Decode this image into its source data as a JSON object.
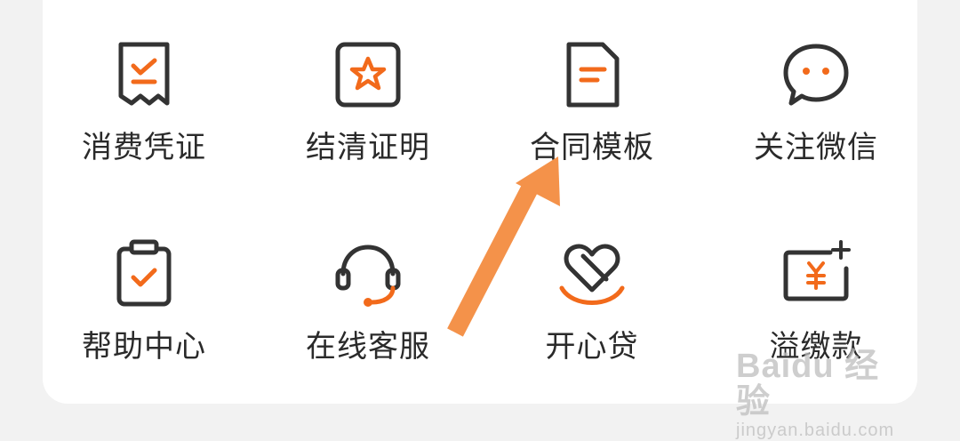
{
  "grid": {
    "items": [
      {
        "label": "消费凭证",
        "icon": "receipt-check-icon"
      },
      {
        "label": "结清证明",
        "icon": "star-certificate-icon"
      },
      {
        "label": "合同模板",
        "icon": "document-icon"
      },
      {
        "label": "关注微信",
        "icon": "chat-bubble-icon"
      },
      {
        "label": "帮助中心",
        "icon": "clipboard-check-icon"
      },
      {
        "label": "在线客服",
        "icon": "headset-icon"
      },
      {
        "label": "开心贷",
        "icon": "heart-smile-icon"
      },
      {
        "label": "溢缴款",
        "icon": "yuan-card-plus-icon"
      }
    ]
  },
  "colors": {
    "accent": "#f26a1b",
    "icon_stroke": "#333333",
    "arrow": "#f4924a",
    "text": "#2a2a2a"
  },
  "watermark": {
    "brand": "Baidu 经验",
    "url": "jingyan.baidu.com"
  }
}
